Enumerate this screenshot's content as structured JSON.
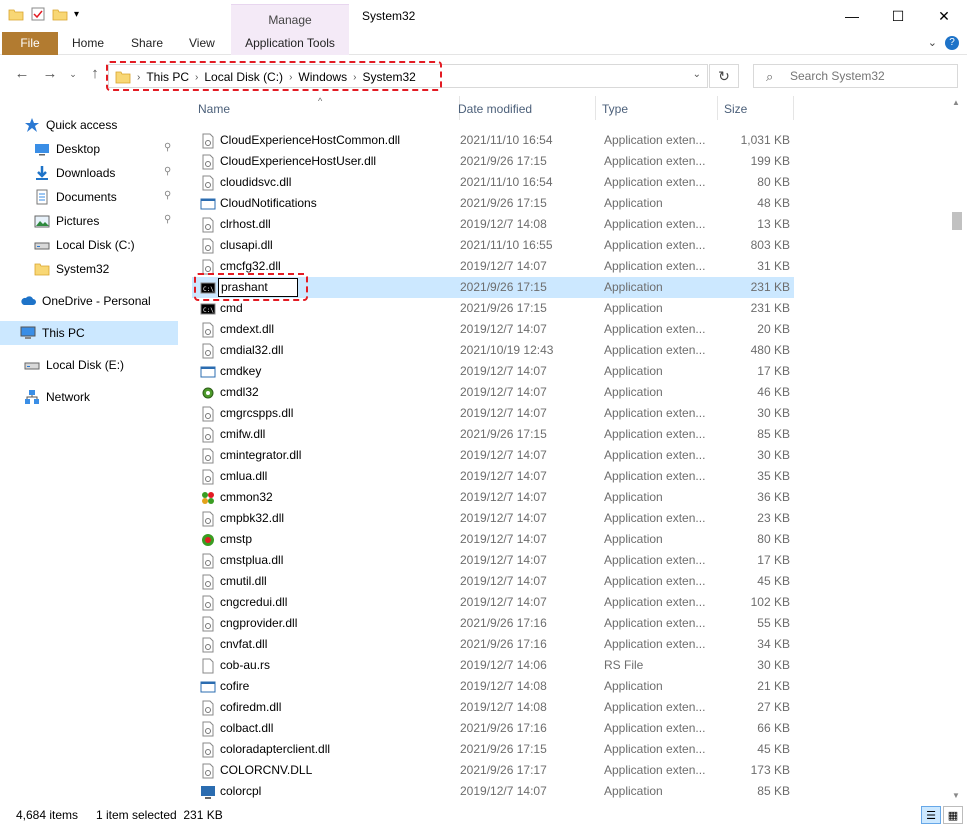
{
  "window": {
    "title": "System32",
    "manage_label": "Manage",
    "minimize": "—",
    "maximize": "☐",
    "close": "✕"
  },
  "ribbon": {
    "tabs": [
      "File",
      "Home",
      "Share",
      "View",
      "Application Tools"
    ]
  },
  "address": {
    "crumbs": [
      "This PC",
      "Local Disk (C:)",
      "Windows",
      "System32"
    ],
    "search_placeholder": "Search System32"
  },
  "sidebar": {
    "items": [
      {
        "label": "Quick access",
        "icon": "star-icon"
      },
      {
        "label": "Desktop",
        "icon": "desktop-icon",
        "pinned": true
      },
      {
        "label": "Downloads",
        "icon": "download-icon",
        "pinned": true
      },
      {
        "label": "Documents",
        "icon": "documents-icon",
        "pinned": true
      },
      {
        "label": "Pictures",
        "icon": "pictures-icon",
        "pinned": true
      },
      {
        "label": "Local Disk (C:)",
        "icon": "drive-icon"
      },
      {
        "label": "System32",
        "icon": "folder-icon"
      },
      {
        "label": "OneDrive - Personal",
        "icon": "cloud-icon"
      },
      {
        "label": "This PC",
        "icon": "computer-icon",
        "selected": true
      },
      {
        "label": "Local Disk (E:)",
        "icon": "drive-icon"
      },
      {
        "label": "Network",
        "icon": "network-icon"
      }
    ]
  },
  "columns": [
    "Name",
    "Date modified",
    "Type",
    "Size"
  ],
  "files": [
    {
      "name": "CloudExperienceHostCommon.dll",
      "date": "2021/11/10 16:54",
      "type": "Application exten...",
      "size": "1,031 KB",
      "icon": "dll"
    },
    {
      "name": "CloudExperienceHostUser.dll",
      "date": "2021/9/26 17:15",
      "type": "Application exten...",
      "size": "199 KB",
      "icon": "dll"
    },
    {
      "name": "cloudidsvc.dll",
      "date": "2021/11/10 16:54",
      "type": "Application exten...",
      "size": "80 KB",
      "icon": "dll"
    },
    {
      "name": "CloudNotifications",
      "date": "2021/9/26 17:15",
      "type": "Application",
      "size": "48 KB",
      "icon": "app"
    },
    {
      "name": "clrhost.dll",
      "date": "2019/12/7 14:08",
      "type": "Application exten...",
      "size": "13 KB",
      "icon": "dll"
    },
    {
      "name": "clusapi.dll",
      "date": "2021/11/10 16:55",
      "type": "Application exten...",
      "size": "803 KB",
      "icon": "dll"
    },
    {
      "name": "cmcfg32.dll",
      "date": "2019/12/7 14:07",
      "type": "Application exten...",
      "size": "31 KB",
      "icon": "dll"
    },
    {
      "name": "prashant",
      "date": "2021/9/26 17:15",
      "type": "Application",
      "size": "231 KB",
      "icon": "cmd",
      "selected": true,
      "renaming": true
    },
    {
      "name": "cmd",
      "date": "2021/9/26 17:15",
      "type": "Application",
      "size": "231 KB",
      "icon": "cmd"
    },
    {
      "name": "cmdext.dll",
      "date": "2019/12/7 14:07",
      "type": "Application exten...",
      "size": "20 KB",
      "icon": "dll"
    },
    {
      "name": "cmdial32.dll",
      "date": "2021/10/19 12:43",
      "type": "Application exten...",
      "size": "480 KB",
      "icon": "dll"
    },
    {
      "name": "cmdkey",
      "date": "2019/12/7 14:07",
      "type": "Application",
      "size": "17 KB",
      "icon": "app"
    },
    {
      "name": "cmdl32",
      "date": "2019/12/7 14:07",
      "type": "Application",
      "size": "46 KB",
      "icon": "gear"
    },
    {
      "name": "cmgrcspps.dll",
      "date": "2019/12/7 14:07",
      "type": "Application exten...",
      "size": "30 KB",
      "icon": "dll"
    },
    {
      "name": "cmifw.dll",
      "date": "2021/9/26 17:15",
      "type": "Application exten...",
      "size": "85 KB",
      "icon": "dll"
    },
    {
      "name": "cmintegrator.dll",
      "date": "2019/12/7 14:07",
      "type": "Application exten...",
      "size": "30 KB",
      "icon": "dll"
    },
    {
      "name": "cmlua.dll",
      "date": "2019/12/7 14:07",
      "type": "Application exten...",
      "size": "35 KB",
      "icon": "dll"
    },
    {
      "name": "cmmon32",
      "date": "2019/12/7 14:07",
      "type": "Application",
      "size": "36 KB",
      "icon": "cmmon"
    },
    {
      "name": "cmpbk32.dll",
      "date": "2019/12/7 14:07",
      "type": "Application exten...",
      "size": "23 KB",
      "icon": "dll"
    },
    {
      "name": "cmstp",
      "date": "2019/12/7 14:07",
      "type": "Application",
      "size": "80 KB",
      "icon": "cmstp"
    },
    {
      "name": "cmstplua.dll",
      "date": "2019/12/7 14:07",
      "type": "Application exten...",
      "size": "17 KB",
      "icon": "dll"
    },
    {
      "name": "cmutil.dll",
      "date": "2019/12/7 14:07",
      "type": "Application exten...",
      "size": "45 KB",
      "icon": "dll"
    },
    {
      "name": "cngcredui.dll",
      "date": "2019/12/7 14:07",
      "type": "Application exten...",
      "size": "102 KB",
      "icon": "dll"
    },
    {
      "name": "cngprovider.dll",
      "date": "2021/9/26 17:16",
      "type": "Application exten...",
      "size": "55 KB",
      "icon": "dll"
    },
    {
      "name": "cnvfat.dll",
      "date": "2021/9/26 17:16",
      "type": "Application exten...",
      "size": "34 KB",
      "icon": "dll"
    },
    {
      "name": "cob-au.rs",
      "date": "2019/12/7 14:06",
      "type": "RS File",
      "size": "30 KB",
      "icon": "file"
    },
    {
      "name": "cofire",
      "date": "2019/12/7 14:08",
      "type": "Application",
      "size": "21 KB",
      "icon": "app"
    },
    {
      "name": "cofiredm.dll",
      "date": "2019/12/7 14:08",
      "type": "Application exten...",
      "size": "27 KB",
      "icon": "dll"
    },
    {
      "name": "colbact.dll",
      "date": "2021/9/26 17:16",
      "type": "Application exten...",
      "size": "66 KB",
      "icon": "dll"
    },
    {
      "name": "coloradapterclient.dll",
      "date": "2021/9/26 17:15",
      "type": "Application exten...",
      "size": "45 KB",
      "icon": "dll"
    },
    {
      "name": "COLORCNV.DLL",
      "date": "2021/9/26 17:17",
      "type": "Application exten...",
      "size": "173 KB",
      "icon": "dll"
    },
    {
      "name": "colorcpl",
      "date": "2019/12/7 14:07",
      "type": "Application",
      "size": "85 KB",
      "icon": "monitor"
    }
  ],
  "status": {
    "items": "4,684 items",
    "selected": "1 item selected  231 KB"
  },
  "colors": {
    "file_tab": "#b27b30",
    "selection": "#cce8ff",
    "highlight": "#e31b23",
    "manage_tab": "#f4eaf7"
  }
}
